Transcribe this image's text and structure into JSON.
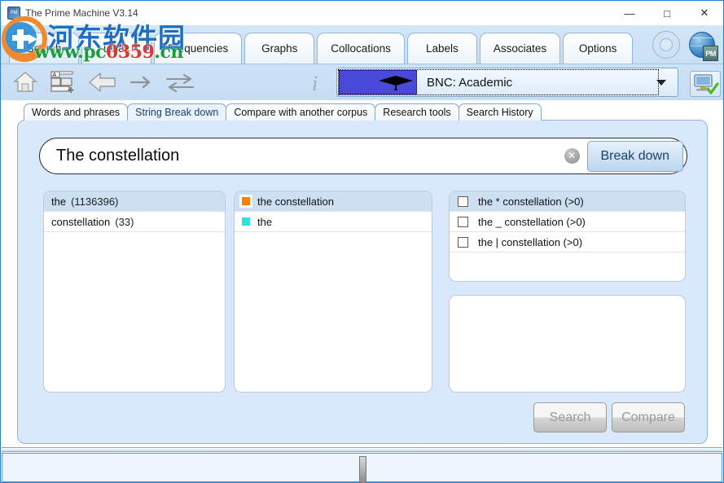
{
  "window": {
    "title": "The Prime Machine V3.14",
    "app_icon": "prime-machine-icon",
    "controls": {
      "minimize": "—",
      "maximize": "□",
      "close": "✕"
    }
  },
  "main_tabs": [
    {
      "label": "Search",
      "active": true
    },
    {
      "label": "Lines",
      "active": false
    },
    {
      "label": "Frequencies",
      "active": false
    },
    {
      "label": "Graphs",
      "active": false
    },
    {
      "label": "Collocations",
      "active": false
    },
    {
      "label": "Labels",
      "active": false
    },
    {
      "label": "Associates",
      "active": false
    },
    {
      "label": "Options",
      "active": false
    }
  ],
  "header_icons": [
    {
      "name": "lifebuoy-help-icon"
    },
    {
      "name": "globe-pm-icon",
      "badge": "PM"
    }
  ],
  "toolbar": {
    "icons": [
      {
        "name": "home-icon"
      },
      {
        "name": "new-tab-icon"
      },
      {
        "name": "back-arrow-icon"
      },
      {
        "name": "forward-arrow-icon"
      },
      {
        "name": "swap-arrows-icon"
      },
      {
        "name": "info-icon"
      }
    ],
    "corpus": {
      "label": "BNC: Academic",
      "swatch_color": "#4a4ad8",
      "swatch_icon": "graduation-cap-icon",
      "caret": "chevron-down-icon"
    },
    "server_status_icon": "monitor-check-icon"
  },
  "sub_tabs": [
    {
      "label": "Words and phrases",
      "active": false
    },
    {
      "label": "String Break down",
      "active": true
    },
    {
      "label": "Compare with another corpus",
      "active": false
    },
    {
      "label": "Research tools",
      "active": false
    },
    {
      "label": "Search History",
      "active": false
    }
  ],
  "search": {
    "value": "The constellation",
    "placeholder": "",
    "clear_icon": "clear-circle-icon",
    "breakdown_label": "Break down"
  },
  "panels": {
    "words": {
      "rows": [
        {
          "word": "the",
          "count": "(1136396)",
          "selected": true
        },
        {
          "word": "constellation",
          "count": "(33)",
          "selected": false
        }
      ]
    },
    "strings": {
      "rows": [
        {
          "label": "the constellation",
          "color": "#ff8000",
          "selected": true
        },
        {
          "label": "the",
          "color": "#2ee0e0",
          "selected": false
        }
      ]
    },
    "patterns": {
      "rows": [
        {
          "label": "the * constellation (>0)",
          "checked": false,
          "selected": true
        },
        {
          "label": "the _ constellation (>0)",
          "checked": false,
          "selected": false
        },
        {
          "label": "the | constellation (>0)",
          "checked": false,
          "selected": false
        }
      ]
    },
    "results": {
      "rows": []
    }
  },
  "buttons": {
    "search": {
      "label": "Search",
      "enabled": false
    },
    "compare": {
      "label": "Compare",
      "enabled": false
    }
  },
  "watermark": {
    "chinese": "河东软件园",
    "url_prefix": "www.pc",
    "url_digits": "0359",
    "url_suffix": ".cn"
  },
  "colors": {
    "accent": "#2b7cd3",
    "content_bg": "#d9e8fa",
    "selection": "#ccdff3",
    "corpus_swatch": "#4a4ad8"
  }
}
